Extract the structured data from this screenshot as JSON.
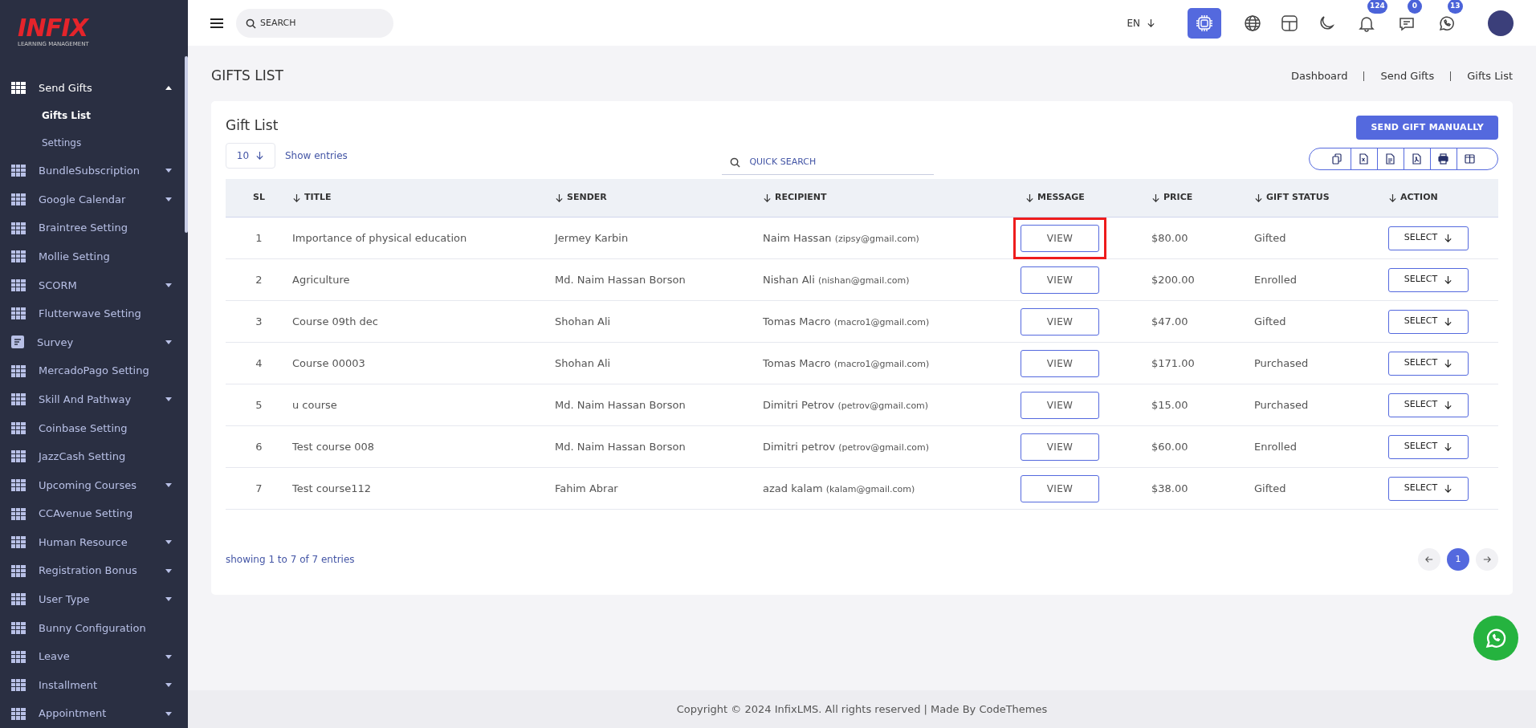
{
  "sidebar": {
    "logo": {
      "wordmark": "INFIX",
      "tagline": "LEARNING MANAGEMENT"
    },
    "items": [
      {
        "label": "Send Gifts",
        "kind": "grid",
        "expanded": true,
        "children": [
          {
            "label": "Gifts List",
            "selected": true
          },
          {
            "label": "Settings",
            "selected": false
          }
        ]
      },
      {
        "label": "BundleSubscription",
        "kind": "grid",
        "expanded": false
      },
      {
        "label": "Google Calendar",
        "kind": "grid",
        "expanded": false
      },
      {
        "label": "Braintree Setting",
        "kind": "grid"
      },
      {
        "label": "Mollie Setting",
        "kind": "grid"
      },
      {
        "label": "SCORM",
        "kind": "grid",
        "expanded": false
      },
      {
        "label": "Flutterwave Setting",
        "kind": "grid"
      },
      {
        "label": "Survey",
        "kind": "doc",
        "expanded": false
      },
      {
        "label": "MercadoPago Setting",
        "kind": "grid"
      },
      {
        "label": "Skill And Pathway",
        "kind": "grid",
        "expanded": false
      },
      {
        "label": "Coinbase Setting",
        "kind": "grid"
      },
      {
        "label": "JazzCash Setting",
        "kind": "grid"
      },
      {
        "label": "Upcoming Courses",
        "kind": "grid",
        "expanded": false
      },
      {
        "label": "CCAvenue Setting",
        "kind": "grid"
      },
      {
        "label": "Human Resource",
        "kind": "grid",
        "expanded": false
      },
      {
        "label": "Registration Bonus",
        "kind": "grid",
        "expanded": false
      },
      {
        "label": "User Type",
        "kind": "grid",
        "expanded": false
      },
      {
        "label": "Bunny Configuration",
        "kind": "grid"
      },
      {
        "label": "Leave",
        "kind": "grid",
        "expanded": false
      },
      {
        "label": "Installment",
        "kind": "grid",
        "expanded": false
      },
      {
        "label": "Appointment",
        "kind": "grid",
        "expanded": false
      }
    ]
  },
  "header": {
    "search": {
      "placeholder": "SEARCH"
    },
    "language": "EN",
    "badges": {
      "notifications": "124",
      "messages": "0",
      "chats": "13"
    }
  },
  "page": {
    "title": "GIFTS LIST",
    "breadcrumb": [
      "Dashboard",
      "Send Gifts",
      "Gifts List"
    ]
  },
  "card": {
    "title": "Gift List",
    "primary_button": "SEND GIFT MANUALLY",
    "page_size": "10",
    "page_size_label": "Show entries",
    "quick_search": {
      "placeholder": "QUICK SEARCH"
    },
    "table": {
      "columns": [
        {
          "label": "SL",
          "sortable": false
        },
        {
          "label": "TITLE",
          "sortable": true
        },
        {
          "label": "SENDER",
          "sortable": true
        },
        {
          "label": "RECIPIENT",
          "sortable": true
        },
        {
          "label": "MESSAGE",
          "sortable": true
        },
        {
          "label": "PRICE",
          "sortable": true
        },
        {
          "label": "GIFT STATUS",
          "sortable": true
        },
        {
          "label": "ACTION",
          "sortable": true
        }
      ],
      "rows": [
        {
          "sl": "1",
          "title": "Importance of physical education",
          "sender": "Jermey Karbin",
          "recipient": "Naim Hassan",
          "email": "(zipsy@gmail.com)",
          "message": "VIEW",
          "highlighted": true,
          "price": "$80.00",
          "status": "Gifted",
          "action": "SELECT"
        },
        {
          "sl": "2",
          "title": "Agriculture",
          "sender": "Md. Naim Hassan Borson",
          "recipient": "Nishan Ali",
          "email": "(nishan@gmail.com)",
          "message": "VIEW",
          "highlighted": false,
          "price": "$200.00",
          "status": "Enrolled",
          "action": "SELECT"
        },
        {
          "sl": "3",
          "title": "Course 09th dec",
          "sender": "Shohan Ali",
          "recipient": "Tomas Macro",
          "email": "(macro1@gmail.com)",
          "message": "VIEW",
          "highlighted": false,
          "price": "$47.00",
          "status": "Gifted",
          "action": "SELECT"
        },
        {
          "sl": "4",
          "title": "Course 00003",
          "sender": "Shohan Ali",
          "recipient": "Tomas Macro",
          "email": "(macro1@gmail.com)",
          "message": "VIEW",
          "highlighted": false,
          "price": "$171.00",
          "status": "Purchased",
          "action": "SELECT"
        },
        {
          "sl": "5",
          "title": "u course",
          "sender": "Md. Naim Hassan Borson",
          "recipient": "Dimitri Petrov",
          "email": "(petrov@gmail.com)",
          "message": "VIEW",
          "highlighted": false,
          "price": "$15.00",
          "status": "Purchased",
          "action": "SELECT"
        },
        {
          "sl": "6",
          "title": "Test course 008",
          "sender": "Md. Naim Hassan Borson",
          "recipient": "Dimitri petrov",
          "email": "(petrov@gmail.com)",
          "message": "VIEW",
          "highlighted": false,
          "price": "$60.00",
          "status": "Enrolled",
          "action": "SELECT"
        },
        {
          "sl": "7",
          "title": "Test course112",
          "sender": "Fahim Abrar",
          "recipient": "azad kalam",
          "email": "(kalam@gmail.com)",
          "message": "VIEW",
          "highlighted": false,
          "price": "$38.00",
          "status": "Gifted",
          "action": "SELECT"
        }
      ]
    },
    "info": "showing 1 to 7 of 7 entries",
    "pages": [
      {
        "label": "1",
        "selected": true
      }
    ]
  },
  "footer": "Copyright © 2024 InfixLMS. All rights reserved | Made By CodeThemes"
}
